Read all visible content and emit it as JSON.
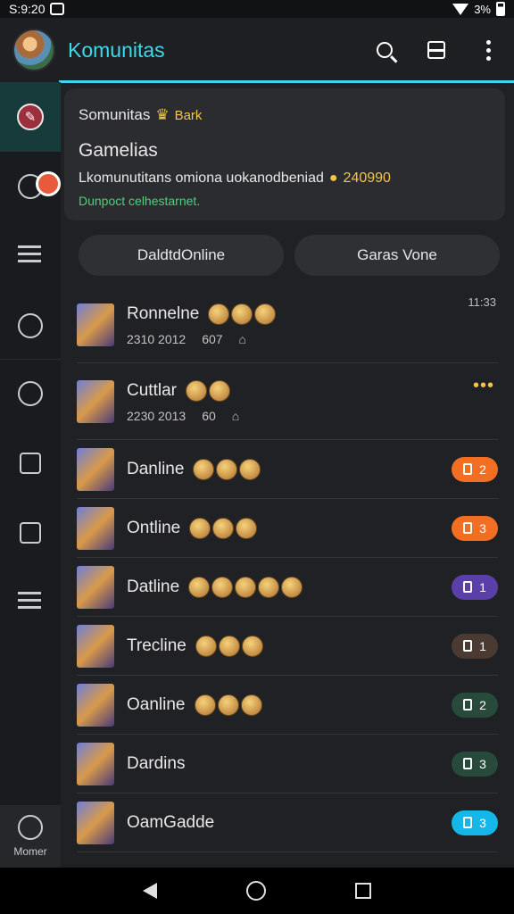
{
  "status_bar": {
    "time": "S:9:20",
    "battery_text": "3%"
  },
  "app_bar": {
    "title": "Komunitas"
  },
  "colors": {
    "accent": "#3fd7ec",
    "online": "#4cd07d",
    "orange": "#f26e22",
    "purple": "#5b3fa8",
    "brown": "#4a3a32",
    "dark_green": "#274a3a",
    "cyan": "#14b7e8"
  },
  "rail": {
    "bottom_label": "Momer"
  },
  "card": {
    "header": "Somunitas",
    "tag": "Bark",
    "title": "Gamelias",
    "line": "Lkomunutitans omiona uokanodbeniad",
    "count": "240990",
    "status": "Dunpoct celhestarnet."
  },
  "filters": [
    "DaldtdOnline",
    "Garas Vone"
  ],
  "rows": [
    {
      "name": "Ronnelne",
      "sub1": "2310 2012",
      "sub2": "607",
      "time": "11:33"
    },
    {
      "name": "Cuttlar",
      "sub1": "2230 2013",
      "sub2": "60",
      "dots": "•••"
    },
    {
      "name": "Danline",
      "badge": "2"
    },
    {
      "name": "Ontline",
      "badge": "3"
    },
    {
      "name": "Datline",
      "badge": "1"
    },
    {
      "name": "Trecline",
      "badge": "1"
    },
    {
      "name": "Oanline",
      "badge": "2"
    },
    {
      "name": "Dardins",
      "badge": "3"
    },
    {
      "name": "OamGadde",
      "badge": "3"
    }
  ]
}
